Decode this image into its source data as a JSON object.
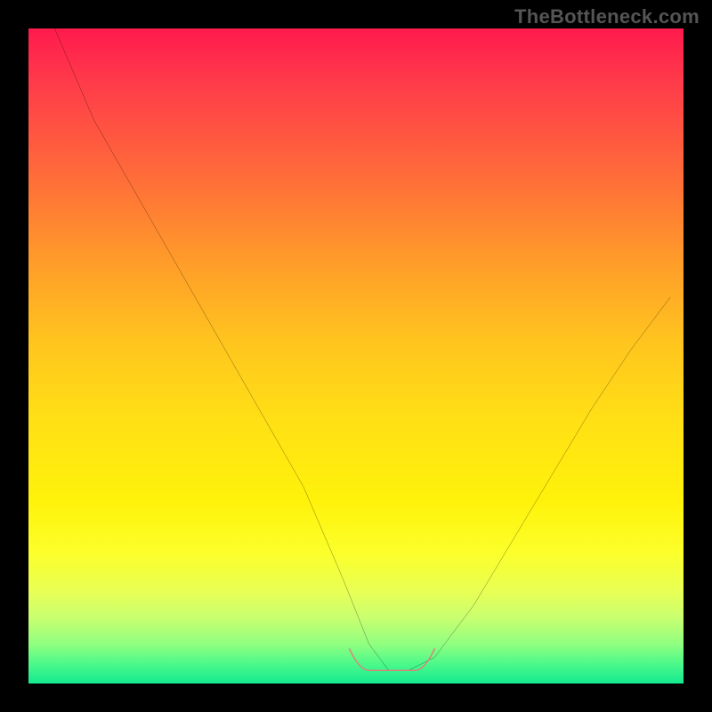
{
  "watermark": "TheBottleneck.com",
  "chart_data": {
    "type": "line",
    "title": "",
    "xlabel": "",
    "ylabel": "",
    "xlim": [
      0,
      100
    ],
    "ylim": [
      0,
      100
    ],
    "note": "Axes are normalized 0-100; no numeric tick labels are visible in the image.",
    "gradient_bands": [
      {
        "pos": 0,
        "color": "#ff1a4d"
      },
      {
        "pos": 50,
        "color": "#ffd81a"
      },
      {
        "pos": 90,
        "color": "#e8ff55"
      },
      {
        "pos": 100,
        "color": "#14e98f"
      }
    ],
    "series": [
      {
        "name": "bottleneck-curve",
        "color": "#000000",
        "x": [
          4,
          10,
          18,
          26,
          34,
          42,
          48,
          52,
          55,
          58,
          62,
          68,
          74,
          80,
          86,
          92,
          98
        ],
        "y": [
          100,
          86,
          72,
          58,
          44,
          30,
          16,
          6,
          2,
          2,
          4,
          12,
          22,
          32,
          42,
          51,
          59
        ]
      }
    ],
    "annotation_region": {
      "name": "optimal-range-marker",
      "color": "#e77a7a",
      "x_start": 49,
      "x_end": 62,
      "y": 2
    }
  }
}
